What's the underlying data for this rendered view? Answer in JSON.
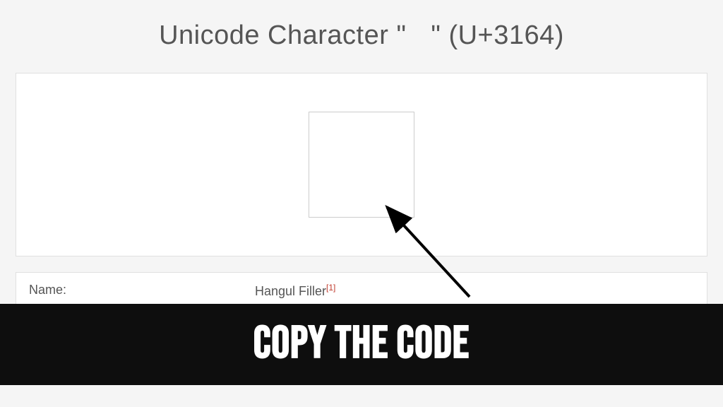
{
  "title": "Unicode Character \"ㅤ\" (U+3164)",
  "info": {
    "name_label": "Name:",
    "name_value": "Hangul Filler",
    "footnote": "[1]"
  },
  "overlay": {
    "caption": "Copy the code"
  }
}
